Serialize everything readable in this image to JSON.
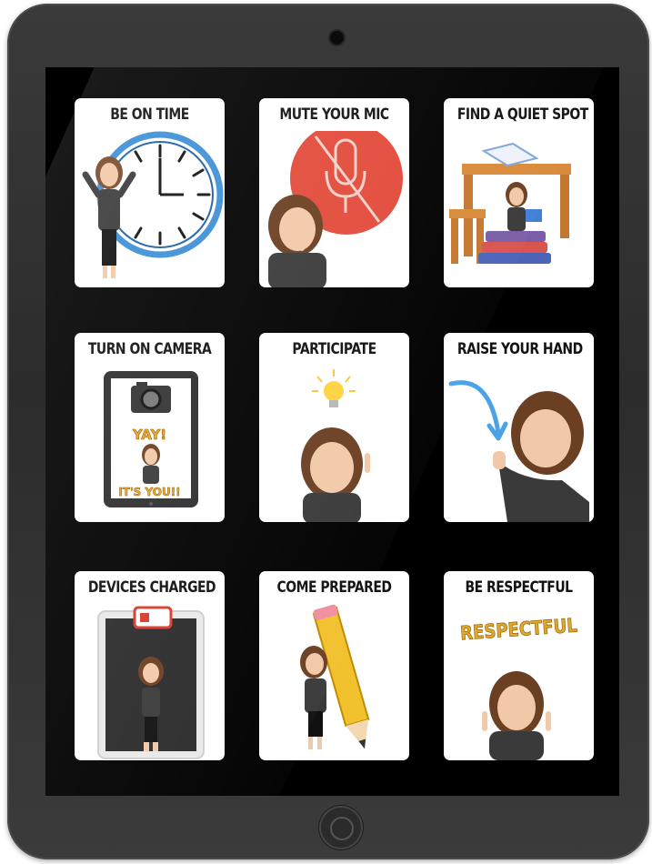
{
  "cards": [
    {
      "title": "BE ON TIME",
      "illustration": "clock-illustration"
    },
    {
      "title": "MUTE YOUR MIC",
      "illustration": "muted-mic-illustration"
    },
    {
      "title": "FIND A QUIET SPOT",
      "illustration": "desk-books-illustration"
    },
    {
      "title": "TURN ON CAMERA",
      "illustration": "tablet-camera-illustration",
      "tablet_text_1": "YAY!",
      "tablet_text_2": "IT'S YOU!!"
    },
    {
      "title": "PARTICIPATE",
      "illustration": "lightbulb-illustration"
    },
    {
      "title": "RAISE YOUR HAND",
      "illustration": "arrow-raise-hand-illustration"
    },
    {
      "title": "DEVICES CHARGED",
      "illustration": "battery-tablet-illustration"
    },
    {
      "title": "COME PREPARED",
      "illustration": "pencil-illustration"
    },
    {
      "title": "BE RESPECTFUL",
      "illustration": "respectful-banner-illustration",
      "banner_text": "RESPECTFUL"
    }
  ],
  "colors": {
    "frame": "#2f2f2f",
    "screen": "#000000",
    "card": "#ffffff",
    "clock_ring": "#3d8fd6",
    "mic_circle": "#e34a3a",
    "arrow": "#4aa3e8",
    "battery": "#d93a2c",
    "pencil": "#f2c12e",
    "banner_gold": "#e0a92e"
  }
}
